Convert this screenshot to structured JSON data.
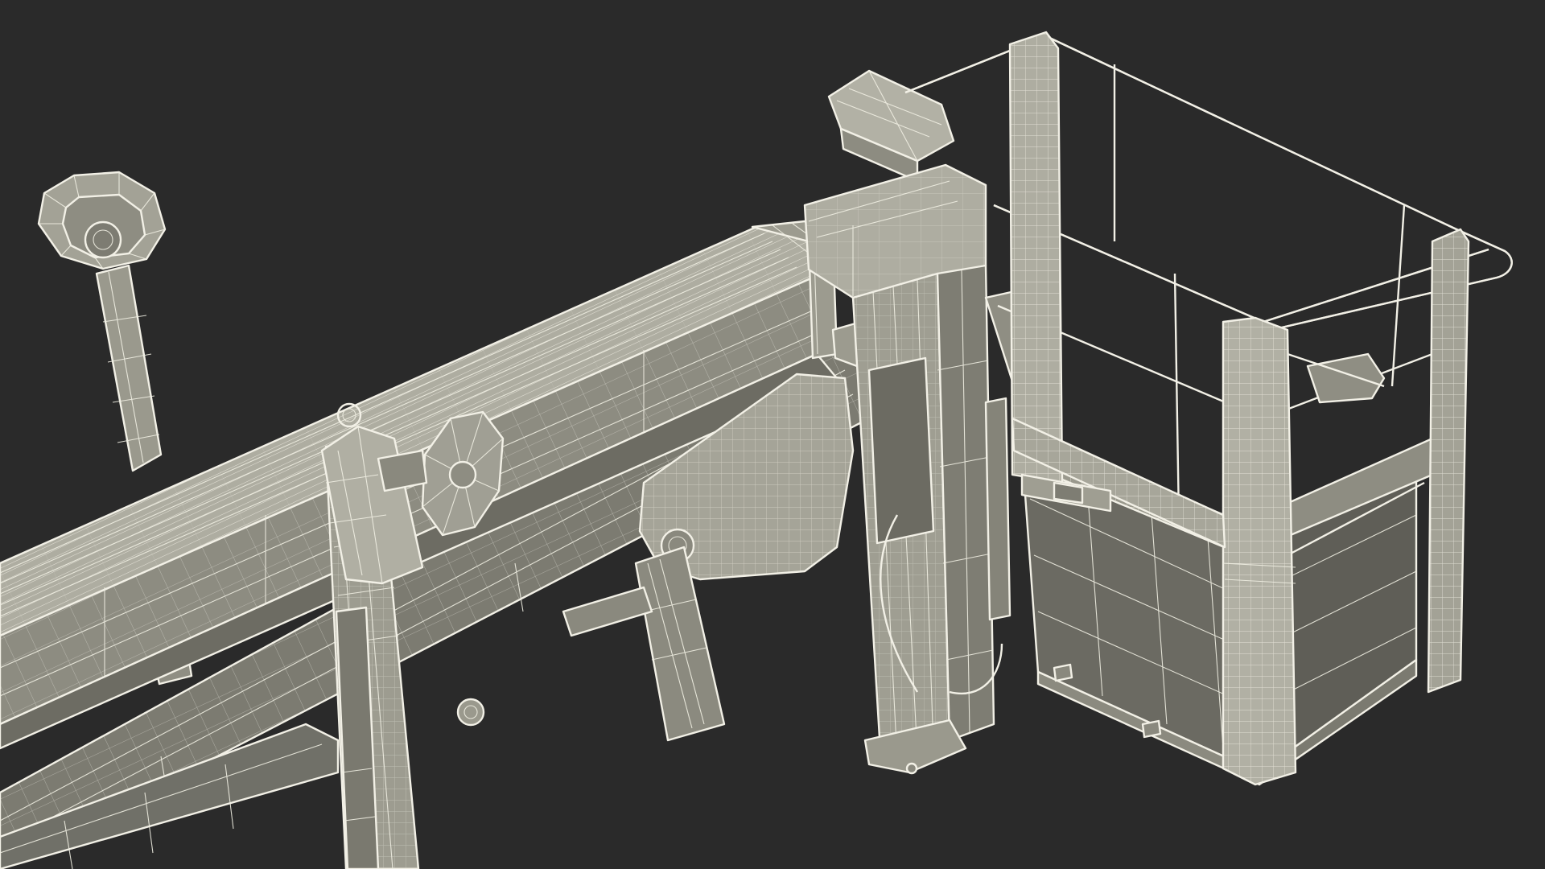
{
  "image": {
    "background_color": "#2a2a2a",
    "surface_colors": {
      "light": "#aaa99d",
      "mid": "#8f8e83",
      "dark": "#74736a",
      "shadow": "#5e5d56",
      "wire": "#f2f0e6"
    },
    "subject_parts": [
      "work-light",
      "telescopic-boom",
      "hydraulic-cylinder",
      "jib-bracket",
      "rotator-column",
      "aerial-platform-basket"
    ]
  }
}
